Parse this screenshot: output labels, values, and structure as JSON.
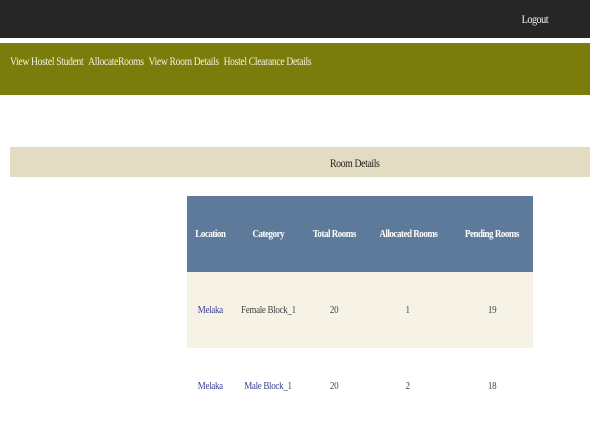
{
  "header": {
    "logout_label": "Logout"
  },
  "nav": {
    "items": [
      {
        "label": "View Hostel Student"
      },
      {
        "label": "AllocateRooms"
      },
      {
        "label": "View Room Details"
      },
      {
        "label": "Hostel Clearance Details"
      }
    ]
  },
  "section": {
    "title": "Room Details"
  },
  "table": {
    "columns": [
      "Location",
      "Category",
      "Total Rooms",
      "Allocated Rooms",
      "Pending Rooms"
    ],
    "rows": [
      {
        "location": "Melaka",
        "category": "Female Block_1",
        "total": "20",
        "allocated": "1",
        "pending": "19"
      },
      {
        "location": "Melaka",
        "category": "Male Block_1",
        "total": "20",
        "allocated": "2",
        "pending": "18"
      }
    ]
  },
  "colors": {
    "topbar": "#262626",
    "navbar": "#7a7c0c",
    "section_bar": "#e3dcc2",
    "table_header": "#5d7a9a",
    "row_alt": "#f6f2e6"
  }
}
